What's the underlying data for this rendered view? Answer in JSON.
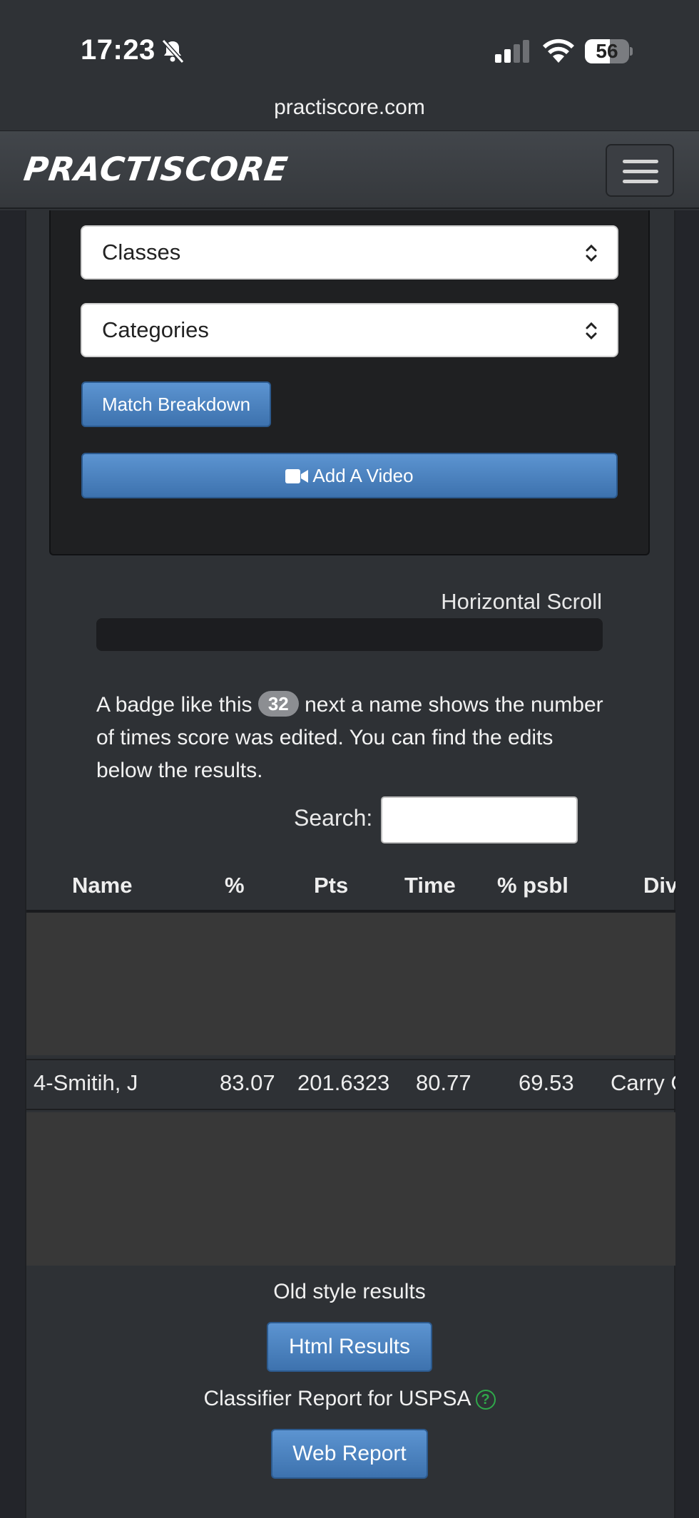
{
  "status_bar": {
    "time": "17:23",
    "battery": "56",
    "battery_level_pct": 56
  },
  "browser": {
    "url": "practiscore.com"
  },
  "navbar": {
    "logo": "PRACTISCORE"
  },
  "filters": {
    "classes_label": "Classes",
    "categories_label": "Categories",
    "match_breakdown_label": "Match Breakdown",
    "add_video_label": "Add A Video"
  },
  "scroll": {
    "label": "Horizontal Scroll"
  },
  "notice": {
    "before": "A badge like this",
    "badge": "32",
    "after": "next a name shows the number of times score was edited. You can find the edits below the results."
  },
  "search": {
    "label": "Search:",
    "value": ""
  },
  "table": {
    "columns": [
      "Name",
      "%",
      "Pts",
      "Time",
      "% psbl",
      "Div"
    ],
    "row": {
      "name": "4-Smitih, J",
      "pct": "83.07",
      "pts": "201.6323",
      "time": "80.77",
      "psbl": "69.53",
      "div": "Carry O"
    }
  },
  "footer": {
    "old_style": "Old style results",
    "html_results": "Html Results",
    "classifier": "Classifier Report for USPSA",
    "web_report": "Web Report"
  },
  "colors": {
    "accent_blue": "#4a84c4",
    "help_green": "#2fa84a"
  }
}
